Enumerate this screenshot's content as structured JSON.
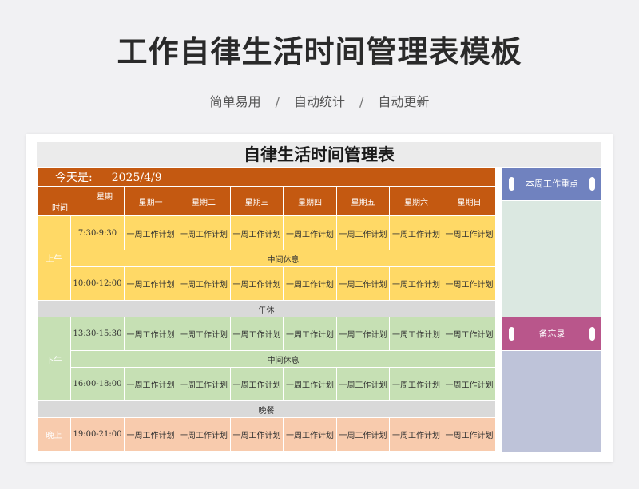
{
  "header": {
    "title": "工作自律生活时间管理表模板",
    "subtitle": [
      "简单易用",
      "自动统计",
      "自动更新"
    ],
    "separator": "/"
  },
  "sheet": {
    "title": "自律生活时间管理表",
    "today_label": "今天是:",
    "today_value": "2025/4/9",
    "corner_top": "星期",
    "corner_bottom": "时间",
    "days": [
      "星期一",
      "星期二",
      "星期三",
      "星期四",
      "星期五",
      "星期六",
      "星期日"
    ],
    "plan_text": "一周工作计划",
    "morning": {
      "period": "上午",
      "slot1": "7:30-9:30",
      "break": "中间休息",
      "slot2": "10:00-12:00"
    },
    "noon_break": "午休",
    "afternoon": {
      "period": "下午",
      "slot1": "13:30-15:30",
      "break": "中间休息",
      "slot2": "16:00-18:00"
    },
    "dinner": "晚餐",
    "evening": {
      "period": "晚上",
      "slot1": "19:00-21:00"
    }
  },
  "side": {
    "focus_title": "本周工作重点",
    "memo_title": "备忘录"
  },
  "colors": {
    "orange": "#c45911",
    "yellow": "#ffd966",
    "green": "#c6e0b4",
    "peach": "#f8cbad",
    "focus_head": "#7082bf",
    "focus_body": "#dbe8e1",
    "memo_head": "#b9568b",
    "memo_body": "#bec3d9"
  }
}
